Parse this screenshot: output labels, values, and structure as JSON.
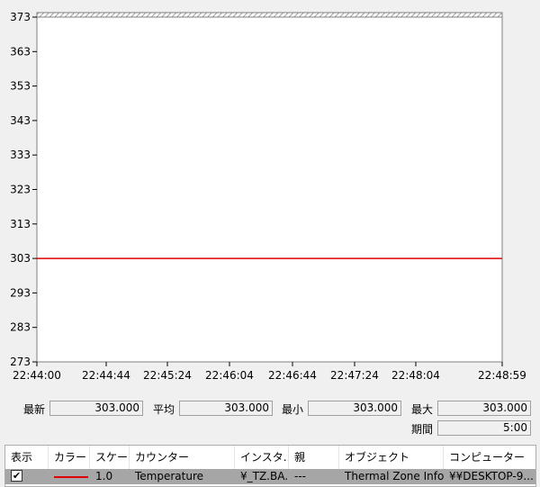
{
  "chart_data": {
    "type": "line",
    "x_ticks": [
      "22:44:00",
      "22:44:44",
      "22:45:24",
      "22:46:04",
      "22:46:44",
      "22:47:24",
      "22:48:04",
      "22:48:59"
    ],
    "y_ticks": [
      "373",
      "363",
      "353",
      "343",
      "333",
      "323",
      "313",
      "303",
      "293",
      "283",
      "273"
    ],
    "ylim": [
      273,
      373
    ],
    "grid": false,
    "series": [
      {
        "color": "#e00000",
        "values": [
          303,
          303,
          303,
          303,
          303,
          303,
          303,
          303
        ]
      }
    ]
  },
  "stats": {
    "latest_label": "最新",
    "latest_value": "303.000",
    "average_label": "平均",
    "average_value": "303.000",
    "minimum_label": "最小",
    "minimum_value": "303.000",
    "maximum_label": "最大",
    "maximum_value": "303.000",
    "duration_label": "期間",
    "duration_value": "5:00"
  },
  "legend": {
    "headers": {
      "show": "表示",
      "color": "カラー",
      "scale": "スケー...",
      "counter": "カウンター",
      "instance": "インスタ...",
      "parent": "親",
      "object": "オブジェクト",
      "computer": "コンピューター"
    },
    "row": {
      "checked": "✔",
      "line_color": "#e00000",
      "scale": "1.0",
      "counter": "Temperature",
      "instance": "¥_TZ.BA...",
      "parent": "---",
      "object": "Thermal Zone Info...",
      "computer": "¥¥DESKTOP-9..."
    }
  }
}
